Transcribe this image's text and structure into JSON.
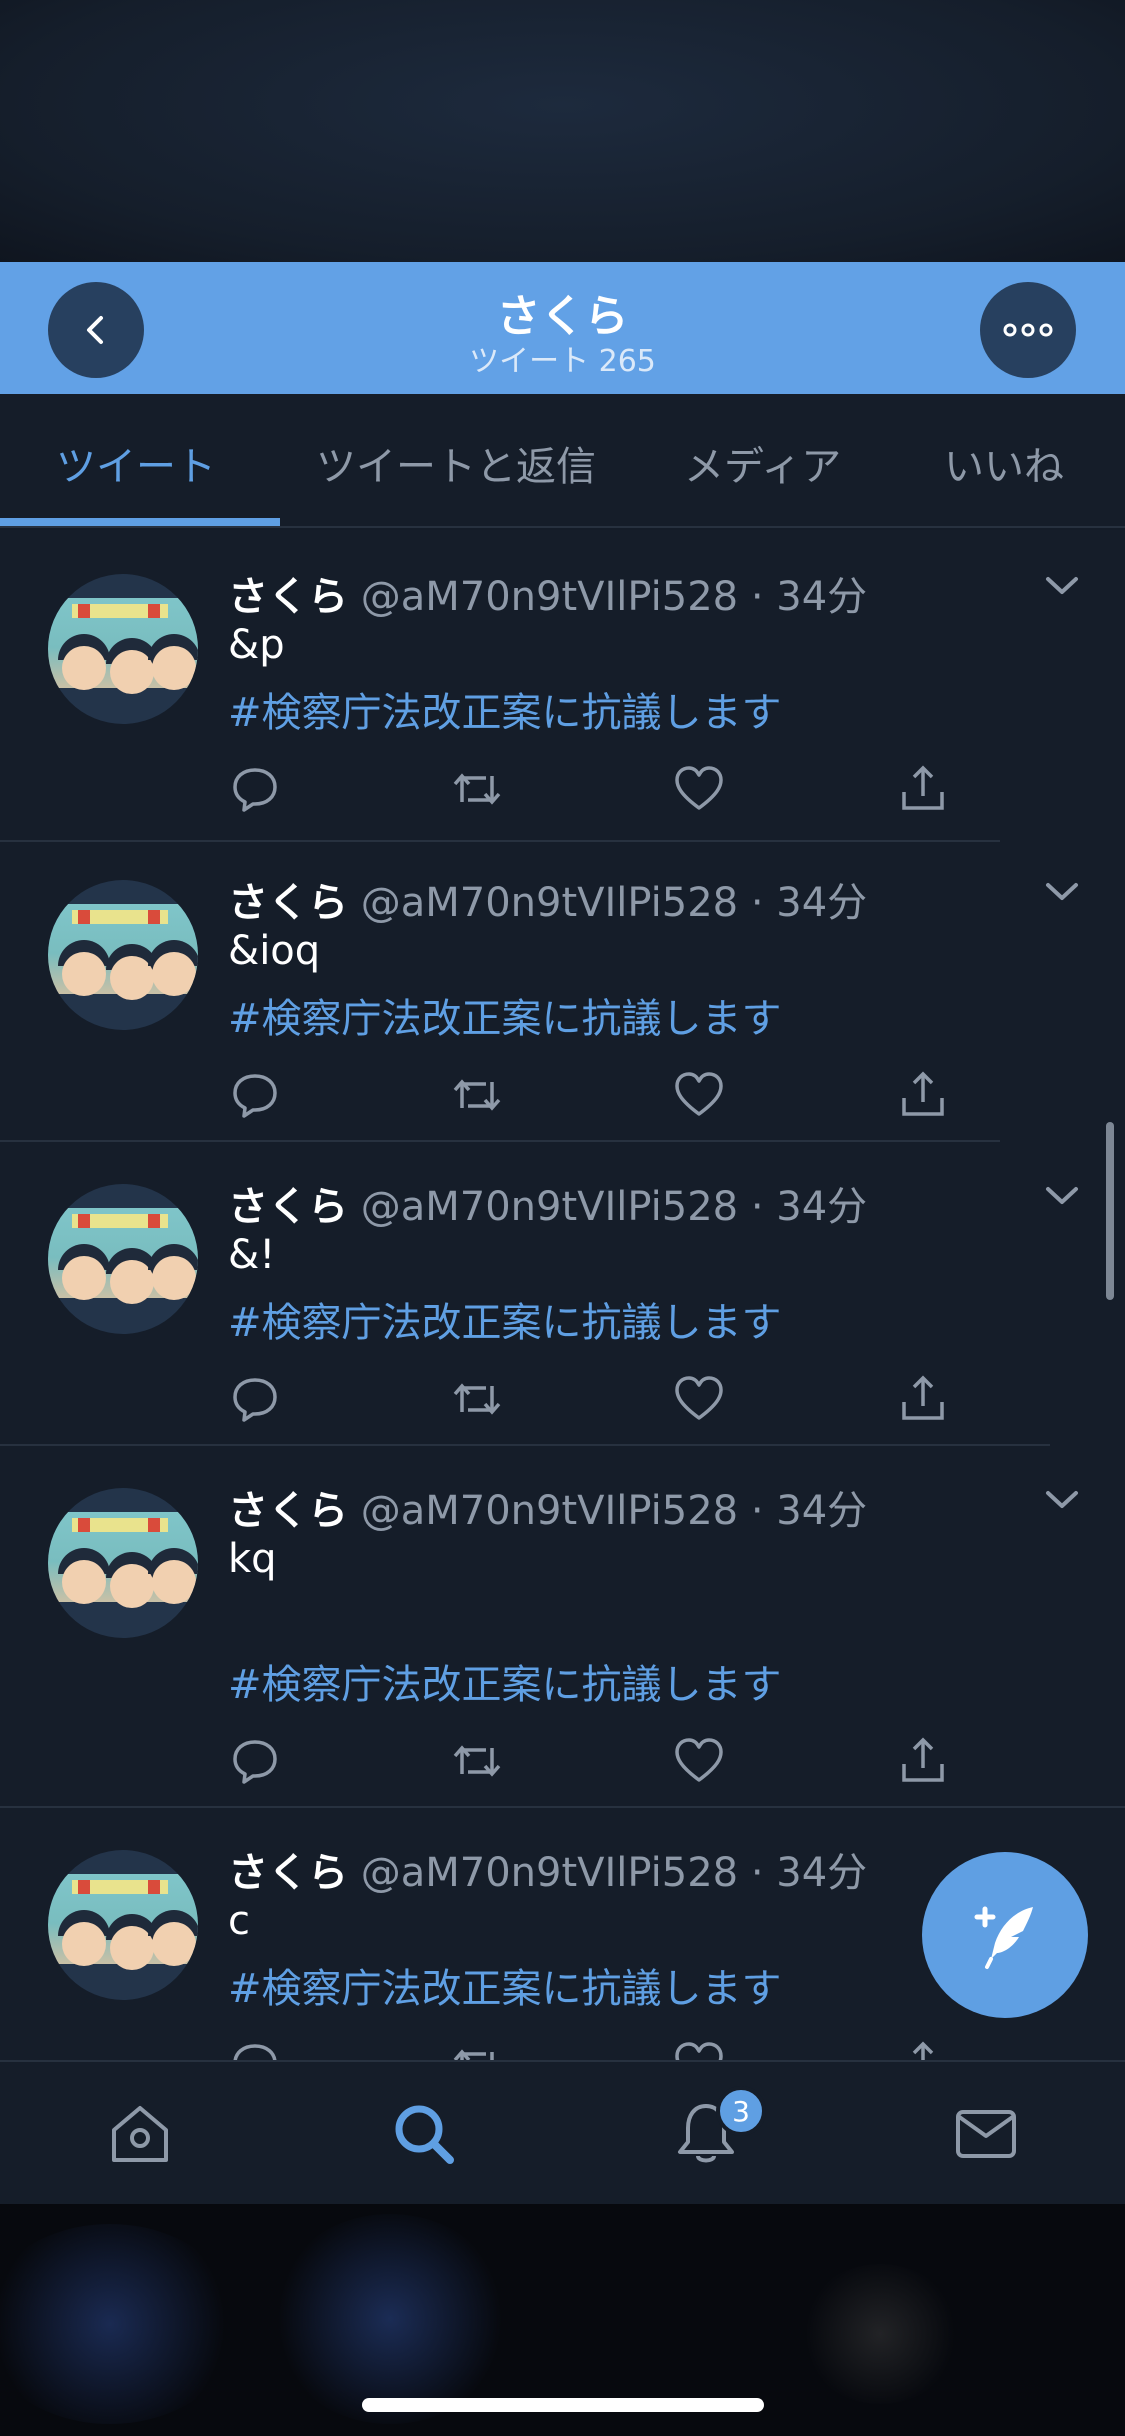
{
  "header": {
    "title": "さくら",
    "subtitle": "ツイート 265"
  },
  "tabs": [
    {
      "label": "ツイート",
      "active": true
    },
    {
      "label": "ツイートと返信",
      "active": false
    },
    {
      "label": "メディア",
      "active": false
    },
    {
      "label": "いいね",
      "active": false
    }
  ],
  "tweets": [
    {
      "name": "さくら",
      "handle": "@aM70n9tVIlPi528 · 34分",
      "text": "&p",
      "hashtag": "#検察庁法改正案に抗議します"
    },
    {
      "name": "さくら",
      "handle": "@aM70n9tVIlPi528 · 34分",
      "text": "&ioq",
      "hashtag": "#検察庁法改正案に抗議します"
    },
    {
      "name": "さくら",
      "handle": "@aM70n9tVIlPi528 · 34分",
      "text": "&!",
      "hashtag": "#検察庁法改正案に抗議します"
    },
    {
      "name": "さくら",
      "handle": "@aM70n9tVIlPi528 · 34分",
      "text": "kq",
      "hashtag": "#検察庁法改正案に抗議します"
    },
    {
      "name": "さくら",
      "handle": "@aM70n9tVIlPi528 · 34分",
      "text": "c",
      "hashtag": "#検察庁法改正案に抗議します"
    }
  ],
  "nav": {
    "notification_count": "3"
  },
  "icons": {
    "back": "chevron-left-icon",
    "more": "more-horizontal-icon",
    "reply": "reply-icon",
    "retweet": "retweet-icon",
    "like": "heart-icon",
    "share": "share-icon",
    "compose": "compose-tweet-icon",
    "home": "home-icon",
    "search": "search-icon",
    "notifications": "bell-icon",
    "messages": "mail-icon"
  },
  "colors": {
    "accent": "#5f9fe3",
    "header_bg": "#62a1e6",
    "background": "#151d29"
  }
}
